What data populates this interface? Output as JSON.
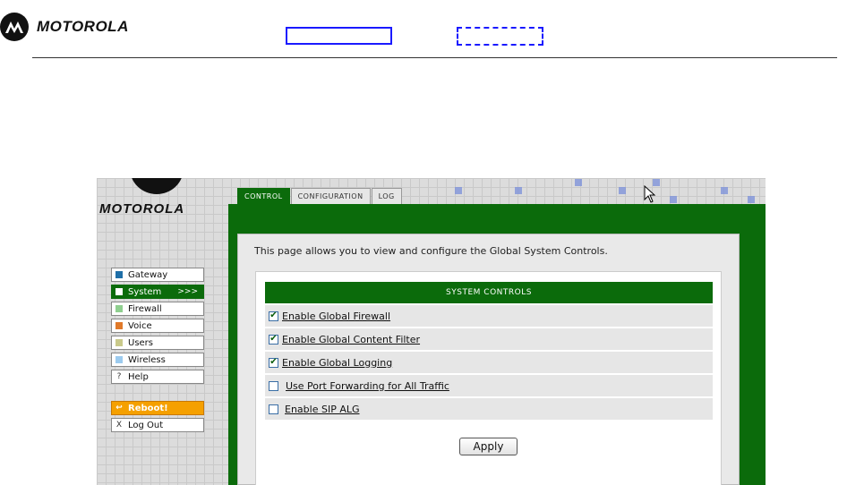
{
  "doc_header": {
    "brand": "MOTOROLA"
  },
  "shot": {
    "brand": "MOTOROLA",
    "tabs": [
      {
        "label": "CONTROL",
        "active": true
      },
      {
        "label": "CONFIGURATION",
        "active": false
      },
      {
        "label": "LOG",
        "active": false
      }
    ],
    "nav": [
      {
        "label": "Gateway",
        "color": "#1f6fa8"
      },
      {
        "label": "System",
        "color": "#ffffff",
        "active": true,
        "arrow": ">>>"
      },
      {
        "label": "Firewall",
        "color": "#8fcf8f"
      },
      {
        "label": "Voice",
        "color": "#e07a2a"
      },
      {
        "label": "Users",
        "color": "#c9c98a"
      },
      {
        "label": "Wireless",
        "color": "#9ccbef"
      },
      {
        "label": "Help",
        "glyph": "?"
      },
      {
        "label": "Reboot!",
        "glyph": "↩",
        "reboot": true
      },
      {
        "label": "Log Out",
        "glyph": "X"
      }
    ],
    "intro_text": "This page allows you to view and configure the Global System Controls.",
    "section_title": "SYSTEM CONTROLS",
    "controls": [
      {
        "label": "Enable Global Firewall",
        "checked": true
      },
      {
        "label": "Enable Global Content Filter",
        "checked": true
      },
      {
        "label": "Enable Global Logging",
        "checked": true
      },
      {
        "label": "Use Port Forwarding for All Traffic",
        "checked": false
      },
      {
        "label": "Enable SIP ALG",
        "checked": false
      }
    ],
    "apply_label": "Apply"
  }
}
